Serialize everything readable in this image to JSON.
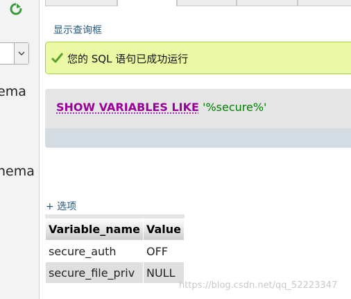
{
  "sidebar": {
    "reload_icon": "reload-icon",
    "schema_items": [
      "ema",
      "nema"
    ]
  },
  "header": {
    "tabs": [
      "",
      "",
      "",
      "",
      ""
    ]
  },
  "main": {
    "show_query_link": "显示查询框",
    "success_message": "您的 SQL 语句已成功运行",
    "sql": {
      "keywords": "SHOW VARIABLES LIKE",
      "string": "'%secure%'"
    },
    "options_link": "+ 选项",
    "table": {
      "columns": [
        "Variable_name",
        "Value"
      ],
      "rows": [
        [
          "secure_auth",
          "OFF"
        ],
        [
          "secure_file_priv",
          "NULL"
        ]
      ]
    }
  },
  "watermark": "https://blog.csdn.net/qq_52223347",
  "colors": {
    "link": "#235a81",
    "success_bg": "#ebf8a4",
    "keyword": "#990099",
    "string": "#008000"
  }
}
